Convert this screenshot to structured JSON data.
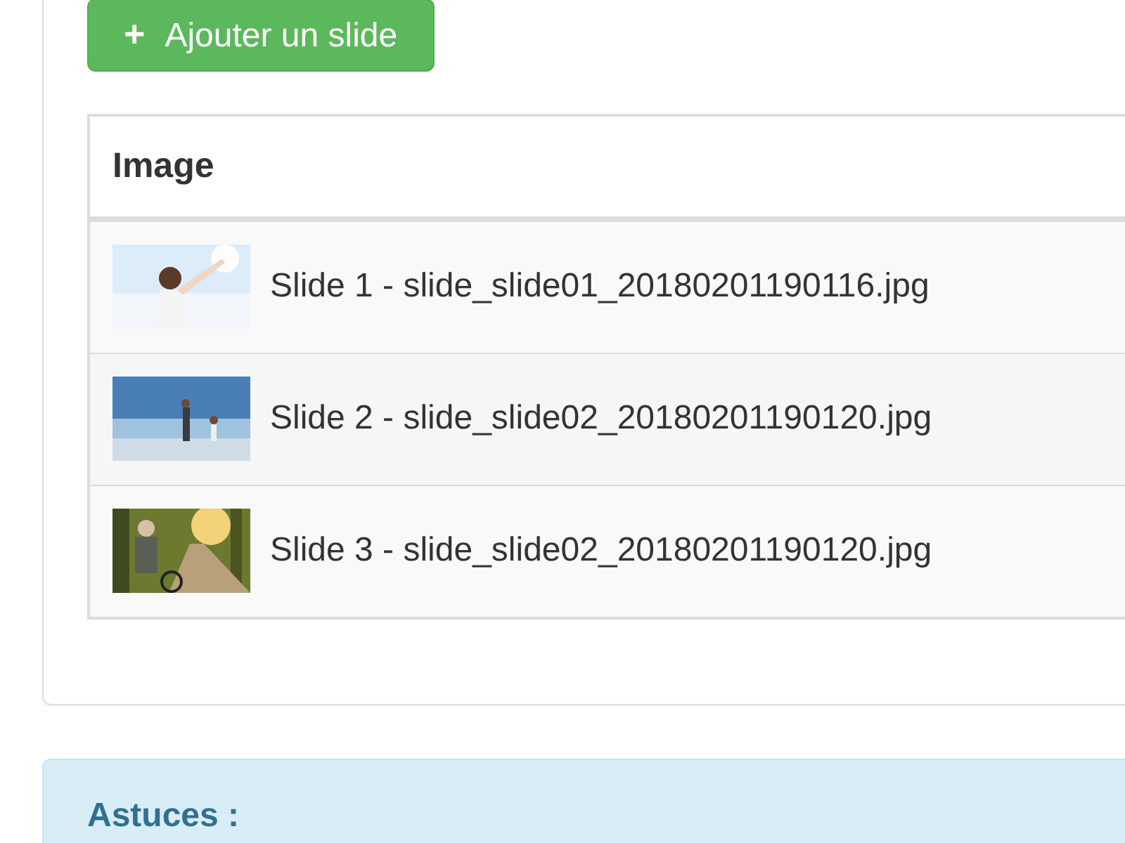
{
  "add_button": {
    "icon": "+",
    "label": "Ajouter un slide"
  },
  "table": {
    "columns": [
      "Image"
    ],
    "rows": [
      {
        "label": "Slide 1 - slide_slide01_20180201190116.jpg"
      },
      {
        "label": "Slide 2 - slide_slide02_20180201190120.jpg"
      },
      {
        "label": "Slide 3 - slide_slide02_20180201190120.jpg"
      }
    ]
  },
  "tips": {
    "title": "Astuces :"
  }
}
